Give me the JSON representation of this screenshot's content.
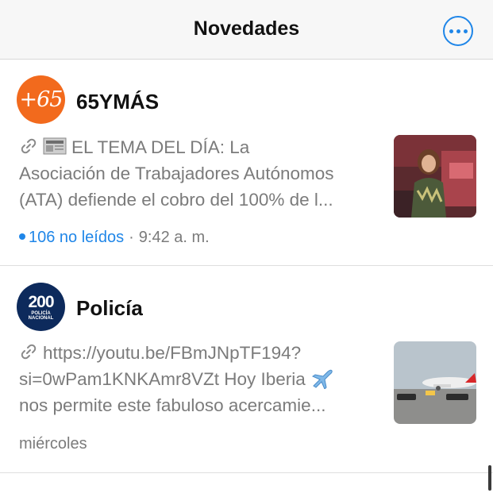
{
  "header": {
    "title": "Novedades",
    "more_icon": "ellipsis-circle-icon",
    "accent_color": "#1f86e8"
  },
  "items": [
    {
      "avatar_text": "+65",
      "avatar_color": "#f26a1d",
      "channel_name": "65YMÁS",
      "preview_lines": [
        "EL TEMA DEL DÍA: La",
        "Asociación de Trabajadores Autónomos",
        "(ATA) defiende el cobro del 100% de l..."
      ],
      "unread_label": "106 no leídos",
      "separator": "·",
      "time": "9:42 a. m.",
      "thumbnail": "woman-in-studio-photo"
    },
    {
      "avatar_number": "200",
      "avatar_subtext_1": "POLICÍA",
      "avatar_subtext_2": "NACIONAL",
      "avatar_color": "#0d2a5c",
      "channel_name": "Policía",
      "preview_lines": [
        "https://youtu.be/FBmJNpTF194?",
        "si=0wPam1KNKAmr8VZt Hoy Iberia",
        "nos permite este fabuloso acercamie..."
      ],
      "time": "miércoles",
      "thumbnail": "airplane-on-tarmac-photo"
    }
  ]
}
